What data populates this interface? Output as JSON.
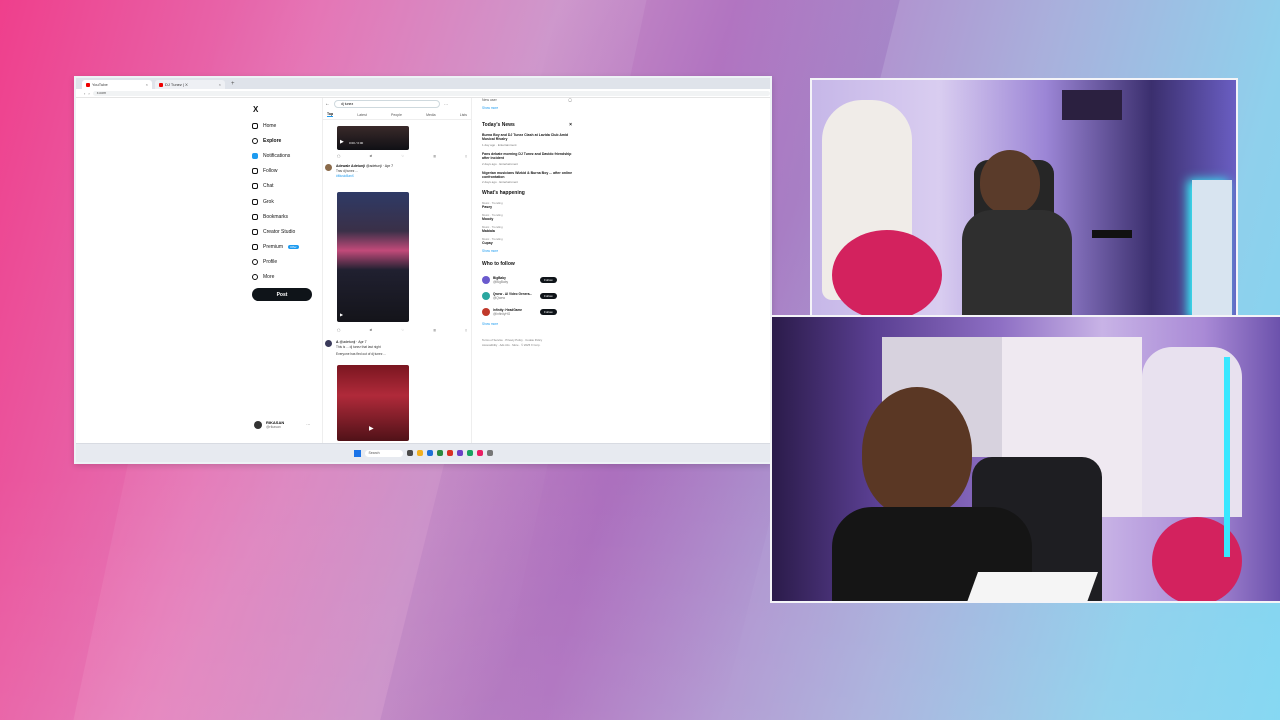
{
  "browser": {
    "tabs": [
      {
        "label": "YouTube",
        "active": true
      },
      {
        "label": "DJ Tunez | X",
        "active": false
      }
    ],
    "new_tab": "+",
    "url": "x.com"
  },
  "x": {
    "logo": "X",
    "nav": [
      {
        "label": "Home",
        "icon": "home-icon"
      },
      {
        "label": "Explore",
        "icon": "search-icon",
        "bold": true
      },
      {
        "label": "Notifications",
        "icon": "bell-icon"
      },
      {
        "label": "Follow",
        "icon": "follow-icon"
      },
      {
        "label": "Chat",
        "icon": "chat-icon"
      },
      {
        "label": "Grok",
        "icon": "grok-icon"
      },
      {
        "label": "Bookmarks",
        "icon": "bookmark-icon"
      },
      {
        "label": "Creator Studio",
        "icon": "lightning-icon"
      },
      {
        "label": "Premium",
        "icon": "x-premium-icon",
        "badge": "Offer"
      },
      {
        "label": "Profile",
        "icon": "person-icon"
      },
      {
        "label": "More",
        "icon": "more-icon"
      }
    ],
    "post_button": "Post",
    "profile": {
      "name": "RIKASAN",
      "handle": "@rikasan",
      "more": "···"
    },
    "search": {
      "value": "dj tunez",
      "back": "←",
      "more": "···"
    },
    "feed_tabs": [
      "Top",
      "Latest",
      "People",
      "Media",
      "Lists"
    ],
    "video_time": "0:00 / 0:00",
    "tweets": [
      {
        "author": "Adewale Adetunji",
        "handle": "@adetunji · Apr 7",
        "text": "Trav dj tunez ...",
        "line2": "#MusicBanX",
        "line3": ""
      },
      {
        "author": "A",
        "handle": "@adetunji · Apr 7",
        "text": "This is ... dj tunez that last night",
        "line2": "Everyone has fled out of dj tunez ...",
        "line3": ""
      }
    ],
    "right": {
      "top": "New user",
      "link": "Show more",
      "news_title": "Today's News",
      "news_close": "×",
      "news": [
        {
          "title": "Burna Boy and DJ Tunez Clash at Lavida Club Amid Musical Rivalry",
          "meta": "1 day ago · Entertainment"
        },
        {
          "title": "Fans debate morning DJ Tunez and Davido friendship after incident",
          "meta": "2 days ago · Entertainment"
        },
        {
          "title": "Nigerian musicians Wizkid & Burna Boy ... after online confrontation",
          "meta": "2 days ago · Entertainment"
        }
      ],
      "happening_title": "What's happening",
      "trends": [
        {
          "cat": "Music · Trending",
          "name": "Pasey"
        },
        {
          "cat": "Music · Trending",
          "name": "Moody"
        },
        {
          "cat": "Music · Trending",
          "name": "Mabiala"
        },
        {
          "cat": "Music · Trending",
          "name": "Cupay"
        }
      ],
      "trends_more": "Show more",
      "follow_title": "Who to follow",
      "follow": [
        {
          "name": "BigBaby",
          "handle": "@BigBaby",
          "button": "Follow"
        },
        {
          "name": "Qwew - AI Video Genera...",
          "handle": "@Qwew",
          "button": "Follow"
        },
        {
          "name": "Infinity: HeadGame",
          "handle": "@InfinityHG",
          "button": "Follow"
        }
      ],
      "follow_more": "Show more",
      "footer": [
        "Terms of Service",
        "Privacy Policy",
        "Cookie Policy",
        "Accessibility",
        "Ads info",
        "More",
        "© 2025 X Corp."
      ]
    }
  },
  "taskbar": {
    "search": "Search"
  }
}
